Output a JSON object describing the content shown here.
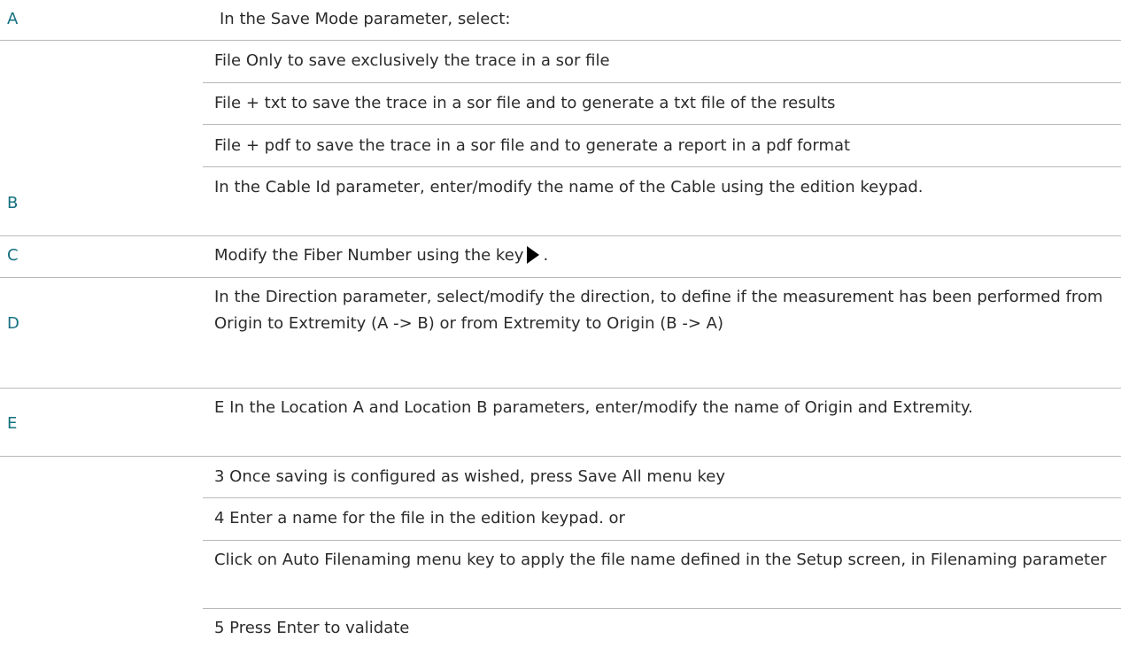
{
  "rows": [
    {
      "step": "A",
      "text": "In the Save Mode parameter, select:"
    },
    {
      "step": "",
      "text": "File Only to save exclusively the trace in a sor file"
    },
    {
      "step": "",
      "text": "File + txt to save the trace in a sor file and to generate a txt file of the results"
    },
    {
      "step": "",
      "text": "File + pdf to save the trace in a sor file and to generate a report in a pdf format"
    },
    {
      "step": "B",
      "text": "In the Cable Id parameter, enter/modify the name of the Cable using the edition keypad."
    },
    {
      "step": "C",
      "text_before": "Modify the Fiber Number using the key",
      "icon": "right-triangle-icon",
      "text_after": "."
    },
    {
      "step": "D",
      "text": "In the Direction parameter, select/modify the direction, to define if the measurement has been performed from Origin to Extremity (A -> B) or from Extremity to Origin (B -> A)"
    },
    {
      "step": "E",
      "text": "E In the Location A and Location B parameters, enter/modify the name of Origin and Extremity."
    },
    {
      "step": "",
      "text": "3 Once saving is configured as wished, press Save All menu key"
    },
    {
      "step": "",
      "text": "4 Enter a name for the file in the edition keypad. or"
    },
    {
      "step": "",
      "text": "Click on Auto Filenaming menu key to apply the file name defined in the Setup screen, in Filenaming parameter"
    },
    {
      "step": "",
      "text": "5 Press Enter to validate"
    }
  ],
  "colors": {
    "step_label": "#13707f",
    "body_text": "#2b2b2b",
    "separator": "#b9b9b9"
  }
}
